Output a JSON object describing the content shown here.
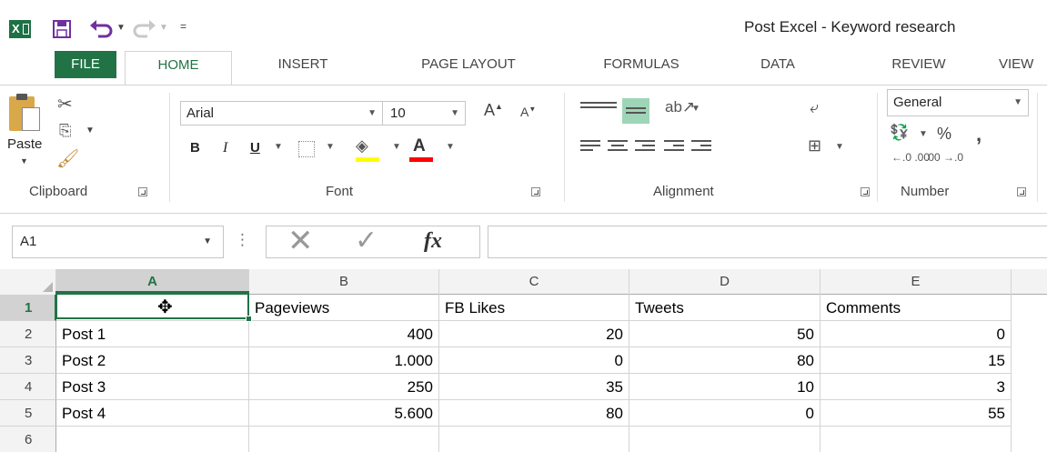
{
  "titlebar": {
    "doc_title": "Post Excel - Keyword research",
    "qat_custom": "="
  },
  "tabs": [
    {
      "label": "FILE"
    },
    {
      "label": "HOME"
    },
    {
      "label": "INSERT"
    },
    {
      "label": "PAGE LAYOUT"
    },
    {
      "label": "FORMULAS"
    },
    {
      "label": "DATA"
    },
    {
      "label": "REVIEW"
    },
    {
      "label": "VIEW"
    }
  ],
  "ribbon": {
    "clipboard": {
      "label": "Clipboard",
      "paste_label": "Paste"
    },
    "font": {
      "label": "Font",
      "font_name": "Arial",
      "font_size": "10",
      "bold": "B",
      "italic": "I",
      "underline": "U",
      "font_color_glyph": "A"
    },
    "alignment": {
      "label": "Alignment"
    },
    "number": {
      "label": "Number",
      "format": "General",
      "percent": "%",
      "comma": ",",
      "inc_decimal": "←.0 .00",
      "dec_decimal": ".00 →.0"
    }
  },
  "formula_bar": {
    "name_box": "A1",
    "fx": "fx",
    "formula": ""
  },
  "grid": {
    "columns": [
      "A",
      "B",
      "C",
      "D",
      "E"
    ],
    "rows": [
      "1",
      "2",
      "3",
      "4",
      "5",
      "6"
    ],
    "cells": [
      [
        "",
        "Pageviews",
        "FB Likes",
        "Tweets",
        "Comments"
      ],
      [
        "Post 1",
        "400",
        "20",
        "50",
        "0"
      ],
      [
        "Post 2",
        "1.000",
        "0",
        "80",
        "15"
      ],
      [
        "Post 3",
        "250",
        "35",
        "10",
        "3"
      ],
      [
        "Post 4",
        "5.600",
        "80",
        "0",
        "55"
      ],
      [
        "",
        "",
        "",
        "",
        ""
      ]
    ]
  },
  "colors": {
    "accent": "#217346",
    "fill_highlight": "#ffff00",
    "font_color": "#ff0000"
  }
}
